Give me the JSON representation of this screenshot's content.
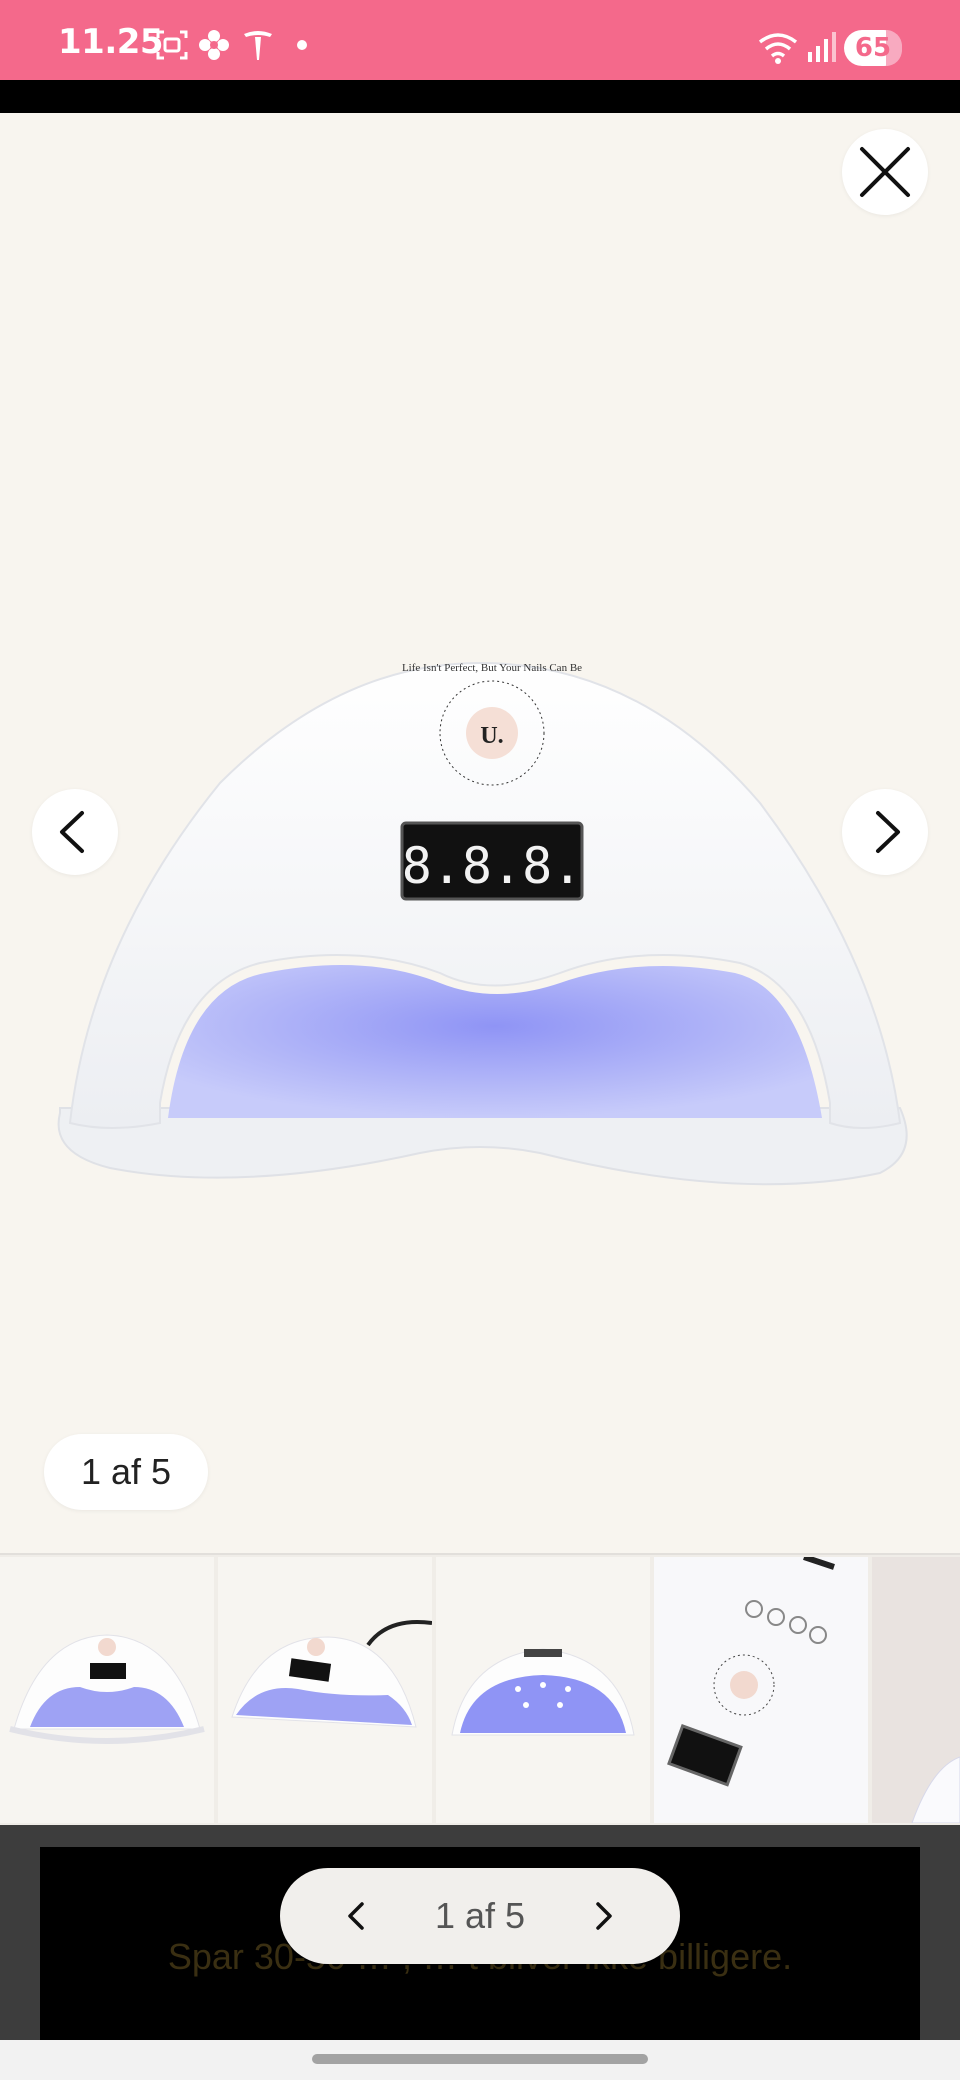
{
  "status_bar": {
    "time": "11.25",
    "battery": "65",
    "icons": [
      "screenshot-icon",
      "flower-icon",
      "tesla-icon",
      "dot-icon",
      "wifi-icon",
      "signal-icon",
      "battery-icon"
    ]
  },
  "viewer": {
    "counter": "1 af 5",
    "image_text": {
      "display": "8.8.8.",
      "ring_text": "Life Isn't Perfect, But Your Nails Can Be",
      "logo": "U."
    }
  },
  "thumbnails": [
    {
      "label": "thumbnail-1"
    },
    {
      "label": "thumbnail-2"
    },
    {
      "label": "thumbnail-3"
    },
    {
      "label": "thumbnail-4"
    },
    {
      "label": "thumbnail-5"
    }
  ],
  "promo": {
    "text": "Spar 30-50 … , … t bliver ikke billigere."
  },
  "pager": {
    "label": "1 af 5"
  },
  "colors": {
    "status_bar": "#f4698b",
    "viewer_bg": "#f8f5ef",
    "lamp_glow": "#8f94f5"
  }
}
